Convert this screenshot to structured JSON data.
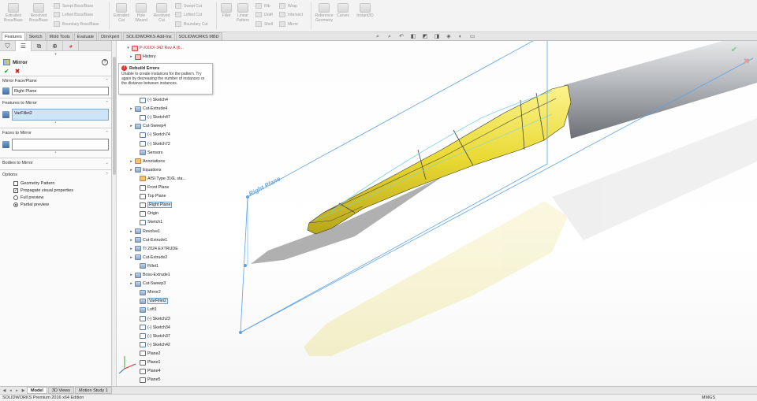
{
  "ribbon": {
    "buttons": [
      {
        "label": "Extruded Boss/Base"
      },
      {
        "label": "Revolved Boss/Base"
      },
      {
        "label": "Extruded Cut"
      },
      {
        "label": "Hole Wizard"
      },
      {
        "label": "Revolved Cut"
      },
      {
        "label": "Fillet"
      },
      {
        "label": "Linear Pattern"
      },
      {
        "label": "Reference Geometry"
      },
      {
        "label": "Curves"
      },
      {
        "label": "Instant3D"
      }
    ],
    "small": [
      {
        "label": "Swept Boss/Base"
      },
      {
        "label": "Lofted Boss/Base"
      },
      {
        "label": "Boundary Boss/Base"
      },
      {
        "label": "Swept Cut"
      },
      {
        "label": "Lofted Cut"
      },
      {
        "label": "Boundary Cut"
      },
      {
        "label": "Rib"
      },
      {
        "label": "Draft"
      },
      {
        "label": "Shell"
      },
      {
        "label": "Wrap"
      },
      {
        "label": "Intersect"
      },
      {
        "label": "Mirror"
      }
    ]
  },
  "cm_tabs": [
    "Features",
    "Sketch",
    "Mold Tools",
    "Evaluate",
    "DimXpert",
    "SOLIDWORKS Add-Ins",
    "SOLIDWORKS MBD"
  ],
  "property_manager": {
    "title": "Mirror",
    "mirror_face_plane": {
      "heading": "Mirror Face/Plane",
      "value": "Right Plane"
    },
    "features_to_mirror": {
      "heading": "Features to Mirror",
      "value": "VarFillet2"
    },
    "faces_to_mirror": {
      "heading": "Faces to Mirror",
      "value": ""
    },
    "bodies_to_mirror": {
      "heading": "Bodies to Mirror"
    },
    "options": {
      "heading": "Options",
      "geometry_pattern": "Geometry Pattern",
      "propagate": "Propagate visual properties",
      "full_preview": "Full preview",
      "partial_preview": "Partial preview"
    }
  },
  "tree": {
    "part_name": "P-XXXX-342 Rev A (6...",
    "history": "History",
    "items": [
      {
        "label": "(-) Sketch4",
        "icon": "sketch-icon",
        "exp": ""
      },
      {
        "label": "Cut-Extrude4",
        "icon": "feature-icon",
        "exp": "▸"
      },
      {
        "label": "(-) Sketch47",
        "icon": "sketch-icon",
        "exp": ""
      },
      {
        "label": "Cut-Sweep4",
        "icon": "feature-icon",
        "exp": "▸"
      },
      {
        "label": "(-) Sketch74",
        "icon": "sketch-icon",
        "exp": ""
      },
      {
        "label": "(-) Sketch72",
        "icon": "sketch-icon",
        "exp": ""
      },
      {
        "label": "Sensors",
        "icon": "sensor-icon",
        "exp": ""
      },
      {
        "label": "Annotations",
        "icon": "annotation-icon",
        "exp": "▸"
      },
      {
        "label": "Equations",
        "icon": "equation-icon",
        "exp": "▸"
      },
      {
        "label": "AISI Type 316L sta...",
        "icon": "material-icon",
        "exp": ""
      },
      {
        "label": "Front Plane",
        "icon": "plane-icon",
        "exp": ""
      },
      {
        "label": "Top Plane",
        "icon": "plane-icon",
        "exp": ""
      },
      {
        "label": "Right Plane",
        "icon": "plane-icon",
        "exp": "",
        "hl": true
      },
      {
        "label": "Origin",
        "icon": "origin-icon",
        "exp": ""
      },
      {
        "label": "Sketch1",
        "icon": "sketch-icon",
        "exp": ""
      },
      {
        "label": "Revolve1",
        "icon": "feature-icon",
        "exp": "▸"
      },
      {
        "label": "Cut-Extrude1",
        "icon": "feature-icon",
        "exp": "▸"
      },
      {
        "label": "TI 2024 EXTRUDE",
        "icon": "feature-icon",
        "exp": "▸"
      },
      {
        "label": "Cut-Extrude2",
        "icon": "feature-icon",
        "exp": "▸"
      },
      {
        "label": "Fillet1",
        "icon": "feature-icon",
        "exp": ""
      },
      {
        "label": "Boss-Extrude1",
        "icon": "feature-icon",
        "exp": "▸"
      },
      {
        "label": "Cut-Sweep3",
        "icon": "feature-icon",
        "exp": "▸"
      },
      {
        "label": "Mirror2",
        "icon": "feature-icon",
        "exp": ""
      },
      {
        "label": "VarFillet2",
        "icon": "feature-icon",
        "exp": "",
        "hl": true
      },
      {
        "label": "Loft1",
        "icon": "feature-icon",
        "exp": ""
      },
      {
        "label": "(-) Sketch23",
        "icon": "sketch-icon",
        "exp": ""
      },
      {
        "label": "(-) Sketch34",
        "icon": "sketch-icon",
        "exp": ""
      },
      {
        "label": "(-) Sketch37",
        "icon": "sketch-icon",
        "exp": ""
      },
      {
        "label": "(-) Sketch42",
        "icon": "sketch-icon",
        "exp": ""
      },
      {
        "label": "Plane2",
        "icon": "plane-icon",
        "exp": ""
      },
      {
        "label": "Plane1",
        "icon": "plane-icon",
        "exp": ""
      },
      {
        "label": "Plane4",
        "icon": "plane-icon",
        "exp": ""
      },
      {
        "label": "Plane5",
        "icon": "plane-icon",
        "exp": ""
      }
    ]
  },
  "tooltip": {
    "title": "Rebuild Errors",
    "body": "Unable to create instances for the pattern. Try again by decreasing the number of instances or the distance between instances."
  },
  "viewport": {
    "plane_label": "Right Plane",
    "body_color": "#e8d83a",
    "plane_color": "#5aa3e6"
  },
  "bottom_tabs": [
    "Model",
    "3D Views",
    "Motion Study 1"
  ],
  "status": {
    "left": "SOLIDWORKS Premium 2016 x64 Edition",
    "right": "MMGS"
  }
}
